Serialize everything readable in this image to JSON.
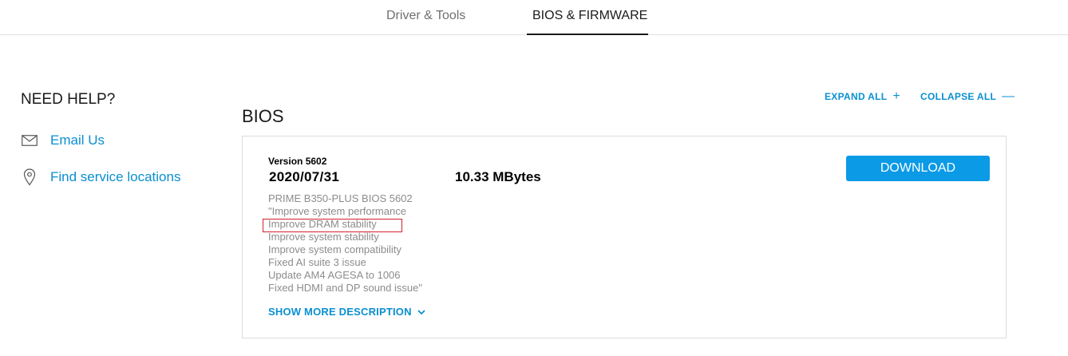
{
  "tabs": [
    {
      "label": "Driver & Tools"
    },
    {
      "label": "BIOS & FIRMWARE"
    }
  ],
  "sidebar": {
    "title": "NEED HELP?",
    "links": [
      {
        "label": "Email Us",
        "icon": "envelope-icon"
      },
      {
        "label": "Find service locations",
        "icon": "location-pin-icon"
      }
    ]
  },
  "controls": {
    "expand_all": "EXPAND ALL",
    "expand_symbol": "+",
    "collapse_all": "COLLAPSE ALL",
    "collapse_symbol": "—"
  },
  "section": {
    "title": "BIOS"
  },
  "bios_item": {
    "version": "Version 5602",
    "date": "2020/07/31",
    "size": "10.33 MBytes",
    "description_lines": [
      "PRIME B350-PLUS BIOS 5602",
      "\"Improve system performance",
      "Improve DRAM stability",
      "Improve system stability",
      "Improve system compatibility",
      "Fixed AI suite 3 issue",
      "Update AM4 AGESA to 1006",
      "Fixed HDMI and DP sound issue\""
    ],
    "show_more": "SHOW MORE DESCRIPTION",
    "download_label": "DOWNLOAD"
  },
  "colors": {
    "accent": "#0a8fd0",
    "button": "#0a9ae6",
    "highlight": "#d0232e",
    "muted_text": "#8c8c8c"
  }
}
